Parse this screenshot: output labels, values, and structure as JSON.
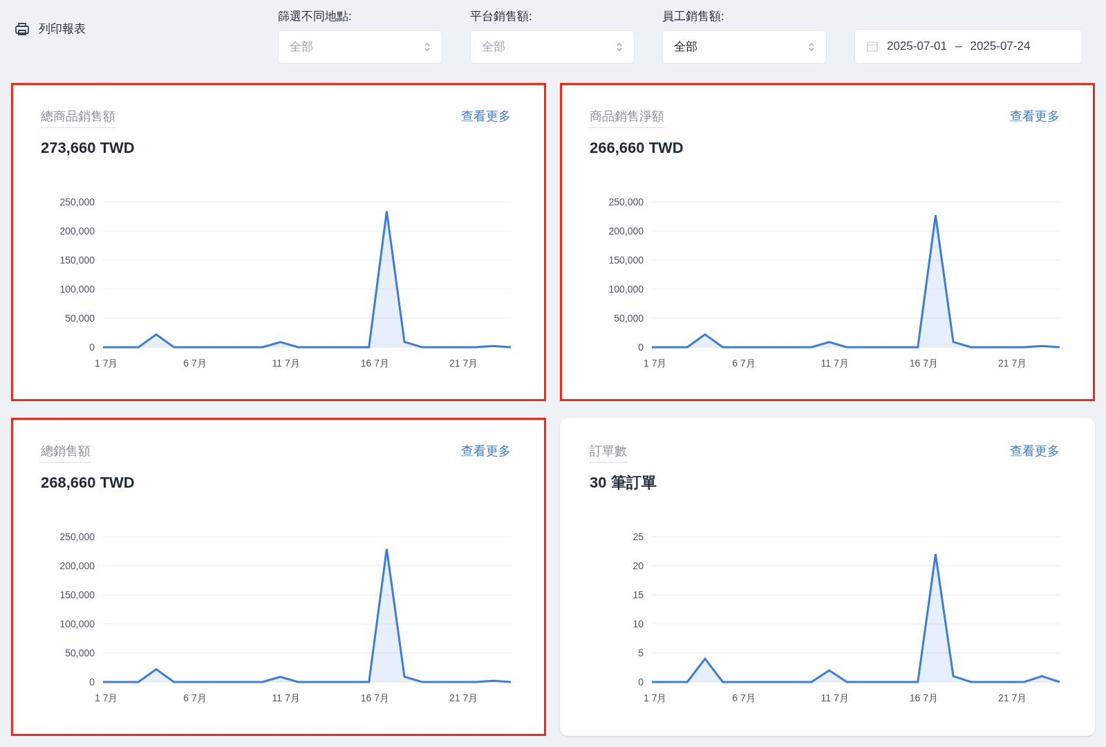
{
  "toolbar": {
    "print_label": "列印報表"
  },
  "filters": [
    {
      "label": "篩選不同地點:",
      "placeholder": "全部"
    },
    {
      "label": "平台銷售額:",
      "placeholder": "全部"
    },
    {
      "label": "員工銷售額:",
      "value": "全部"
    }
  ],
  "date_range": {
    "start": "2025-07-01",
    "separator": "–",
    "end": "2025-07-24"
  },
  "cards": [
    {
      "title": "總商品銷售額",
      "link": "查看更多",
      "value": "273,660 TWD",
      "highlighted": true,
      "chart_data": {
        "type": "area",
        "grid": true,
        "categories": [
          "1 7月",
          null,
          null,
          null,
          null,
          "6 7月",
          null,
          null,
          null,
          null,
          "11 7月",
          null,
          null,
          null,
          null,
          "16 7月",
          null,
          null,
          null,
          null,
          "21 7月",
          null,
          null,
          null
        ],
        "ylim": [
          0,
          250000
        ],
        "yticks": [
          {
            "value": 0,
            "label": "0"
          },
          {
            "value": 50000,
            "label": "50,000"
          },
          {
            "value": 100000,
            "label": "100,000"
          },
          {
            "value": 150000,
            "label": "150,000"
          },
          {
            "value": 200000,
            "label": "200,000"
          },
          {
            "value": 250000,
            "label": "250,000"
          }
        ],
        "series": [
          {
            "color": "#3b7ddd",
            "values": [
              0,
              0,
              0,
              22000,
              0,
              0,
              0,
              0,
              0,
              0,
              9000,
              0,
              0,
              0,
              0,
              0,
              234000,
              9000,
              0,
              0,
              0,
              0,
              2000,
              0
            ]
          }
        ]
      }
    },
    {
      "title": "商品銷售淨額",
      "link": "查看更多",
      "value": "266,660 TWD",
      "highlighted": true,
      "chart_data": {
        "type": "area",
        "grid": true,
        "categories": [
          "1 7月",
          null,
          null,
          null,
          null,
          "6 7月",
          null,
          null,
          null,
          null,
          "11 7月",
          null,
          null,
          null,
          null,
          "16 7月",
          null,
          null,
          null,
          null,
          "21 7月",
          null,
          null,
          null
        ],
        "ylim": [
          0,
          250000
        ],
        "yticks": [
          {
            "value": 0,
            "label": "0"
          },
          {
            "value": 50000,
            "label": "50,000"
          },
          {
            "value": 100000,
            "label": "100,000"
          },
          {
            "value": 150000,
            "label": "150,000"
          },
          {
            "value": 200000,
            "label": "200,000"
          },
          {
            "value": 250000,
            "label": "250,000"
          }
        ],
        "series": [
          {
            "color": "#3b7ddd",
            "values": [
              0,
              0,
              0,
              22000,
              0,
              0,
              0,
              0,
              0,
              0,
              9000,
              0,
              0,
              0,
              0,
              0,
              227000,
              9000,
              0,
              0,
              0,
              0,
              2000,
              0
            ]
          }
        ]
      }
    },
    {
      "title": "總銷售額",
      "link": "查看更多",
      "value": "268,660 TWD",
      "highlighted": true,
      "chart_data": {
        "type": "area",
        "grid": true,
        "categories": [
          "1 7月",
          null,
          null,
          null,
          null,
          "6 7月",
          null,
          null,
          null,
          null,
          "11 7月",
          null,
          null,
          null,
          null,
          "16 7月",
          null,
          null,
          null,
          null,
          "21 7月",
          null,
          null,
          null
        ],
        "ylim": [
          0,
          250000
        ],
        "yticks": [
          {
            "value": 0,
            "label": "0"
          },
          {
            "value": 50000,
            "label": "50,000"
          },
          {
            "value": 100000,
            "label": "100,000"
          },
          {
            "value": 150000,
            "label": "150,000"
          },
          {
            "value": 200000,
            "label": "200,000"
          },
          {
            "value": 250000,
            "label": "250,000"
          }
        ],
        "series": [
          {
            "color": "#3b7ddd",
            "values": [
              0,
              0,
              0,
              22000,
              0,
              0,
              0,
              0,
              0,
              0,
              9000,
              0,
              0,
              0,
              0,
              0,
              229000,
              9000,
              0,
              0,
              0,
              0,
              2000,
              0
            ]
          }
        ]
      }
    },
    {
      "title": "訂單數",
      "link": "查看更多",
      "value": "30 筆訂單",
      "highlighted": false,
      "chart_data": {
        "type": "area",
        "grid": true,
        "categories": [
          "1 7月",
          null,
          null,
          null,
          null,
          "6 7月",
          null,
          null,
          null,
          null,
          "11 7月",
          null,
          null,
          null,
          null,
          "16 7月",
          null,
          null,
          null,
          null,
          "21 7月",
          null,
          null,
          null
        ],
        "ylim": [
          0,
          25
        ],
        "yticks": [
          {
            "value": 0,
            "label": "0"
          },
          {
            "value": 5,
            "label": "5"
          },
          {
            "value": 10,
            "label": "10"
          },
          {
            "value": 15,
            "label": "15"
          },
          {
            "value": 20,
            "label": "20"
          },
          {
            "value": 25,
            "label": "25"
          }
        ],
        "series": [
          {
            "color": "#3b7ddd",
            "values": [
              0,
              0,
              0,
              4,
              0,
              0,
              0,
              0,
              0,
              0,
              2,
              0,
              0,
              0,
              0,
              0,
              22,
              1,
              0,
              0,
              0,
              0,
              1,
              0
            ]
          }
        ]
      }
    }
  ]
}
